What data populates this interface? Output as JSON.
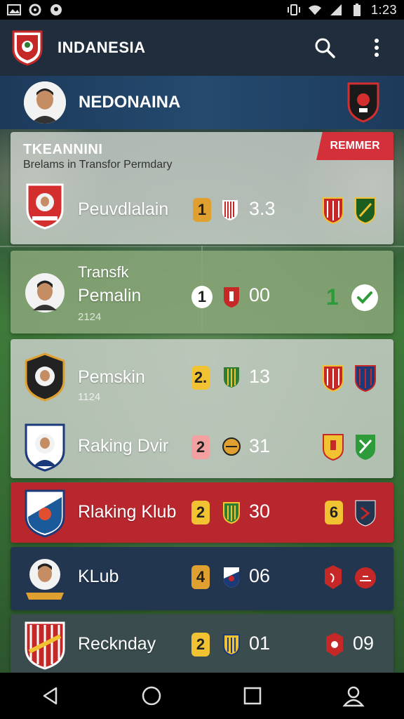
{
  "status_bar": {
    "time": "1:23",
    "left_icons": [
      "image-icon",
      "sync-icon",
      "location-icon"
    ],
    "right_icons": [
      "vibrate-icon",
      "wifi-icon",
      "signal-icon",
      "battery-icon"
    ]
  },
  "app_bar": {
    "title": "INDANESIA",
    "actions": [
      "search-icon",
      "more-vert-icon"
    ]
  },
  "header": {
    "title": "NEDONAINA"
  },
  "top_card": {
    "title": "TKEANNINI",
    "subtitle": "Brelams in Transfor Permdary",
    "ribbon": "REMMER",
    "row": {
      "name": "Peuvdlalain",
      "badge": "1",
      "score": "3.3"
    }
  },
  "transfer_card": {
    "label": "Transfk",
    "name": "Pemalin",
    "year": "2124",
    "badge": "1",
    "score": "00",
    "right_number": "1"
  },
  "rows": [
    {
      "name": "Pemskin",
      "sub": "1124",
      "badge": "2.",
      "score": "13"
    },
    {
      "name": "Raking Dvir",
      "badge": "2",
      "score": "31"
    },
    {
      "name": "Rlaking Klub",
      "badge": "2",
      "score": "30",
      "right_badge": "6"
    },
    {
      "name": "KLub",
      "badge": "4",
      "score": "06"
    },
    {
      "name": "Recknday",
      "badge": "2",
      "score": "01",
      "right_score": "09"
    }
  ],
  "colors": {
    "accent_red": "#d3303a",
    "card_red": "#b8262e",
    "navy": "#223650",
    "badge_orange": "#e0a030",
    "badge_yellow": "#f1c232",
    "check_green": "#2e9b3a"
  },
  "nav_bar": [
    "back-icon",
    "home-icon",
    "recents-icon",
    "profile-icon"
  ]
}
